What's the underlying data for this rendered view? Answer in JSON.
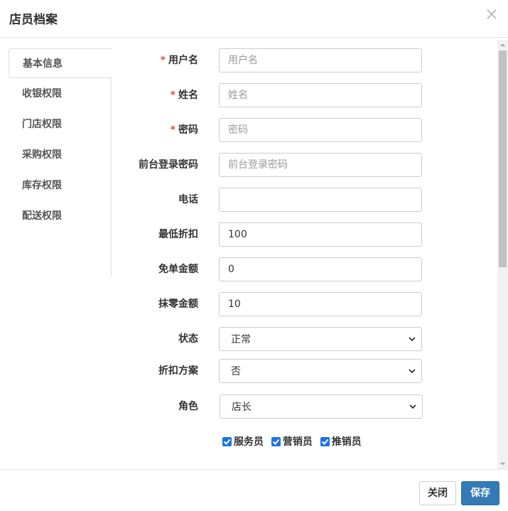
{
  "dialog": {
    "title": "店员档案"
  },
  "tabs": [
    {
      "label": "基本信息",
      "active": true
    },
    {
      "label": "收银权限",
      "active": false
    },
    {
      "label": "门店权限",
      "active": false
    },
    {
      "label": "采购权限",
      "active": false
    },
    {
      "label": "库存权限",
      "active": false
    },
    {
      "label": "配送权限",
      "active": false
    }
  ],
  "form": {
    "required_mark": "*",
    "username": {
      "label": "用户名",
      "value": "",
      "placeholder": "用户名",
      "required": true
    },
    "name": {
      "label": "姓名",
      "value": "",
      "placeholder": "姓名",
      "required": true
    },
    "password": {
      "label": "密码",
      "value": "",
      "placeholder": "密码",
      "required": true
    },
    "pos_password": {
      "label": "前台登录密码",
      "value": "",
      "placeholder": "前台登录密码"
    },
    "phone": {
      "label": "电话",
      "value": ""
    },
    "min_discount": {
      "label": "最低折扣",
      "value": "100"
    },
    "waive_amount": {
      "label": "免单金额",
      "value": "0"
    },
    "rounding_amount": {
      "label": "抹零金额",
      "value": "10"
    },
    "status": {
      "label": "状态",
      "value": "正常"
    },
    "discount_plan": {
      "label": "折扣方案",
      "value": "否"
    },
    "role": {
      "label": "角色",
      "value": "店长"
    },
    "roles_checkboxes": [
      {
        "label": "服务员",
        "checked": true
      },
      {
        "label": "营销员",
        "checked": true
      },
      {
        "label": "推销员",
        "checked": true
      }
    ]
  },
  "footer": {
    "close_label": "关闭",
    "save_label": "保存"
  },
  "colors": {
    "primary": "#337ab7",
    "required": "#d9534f",
    "checkbox": "#1a73e8"
  }
}
